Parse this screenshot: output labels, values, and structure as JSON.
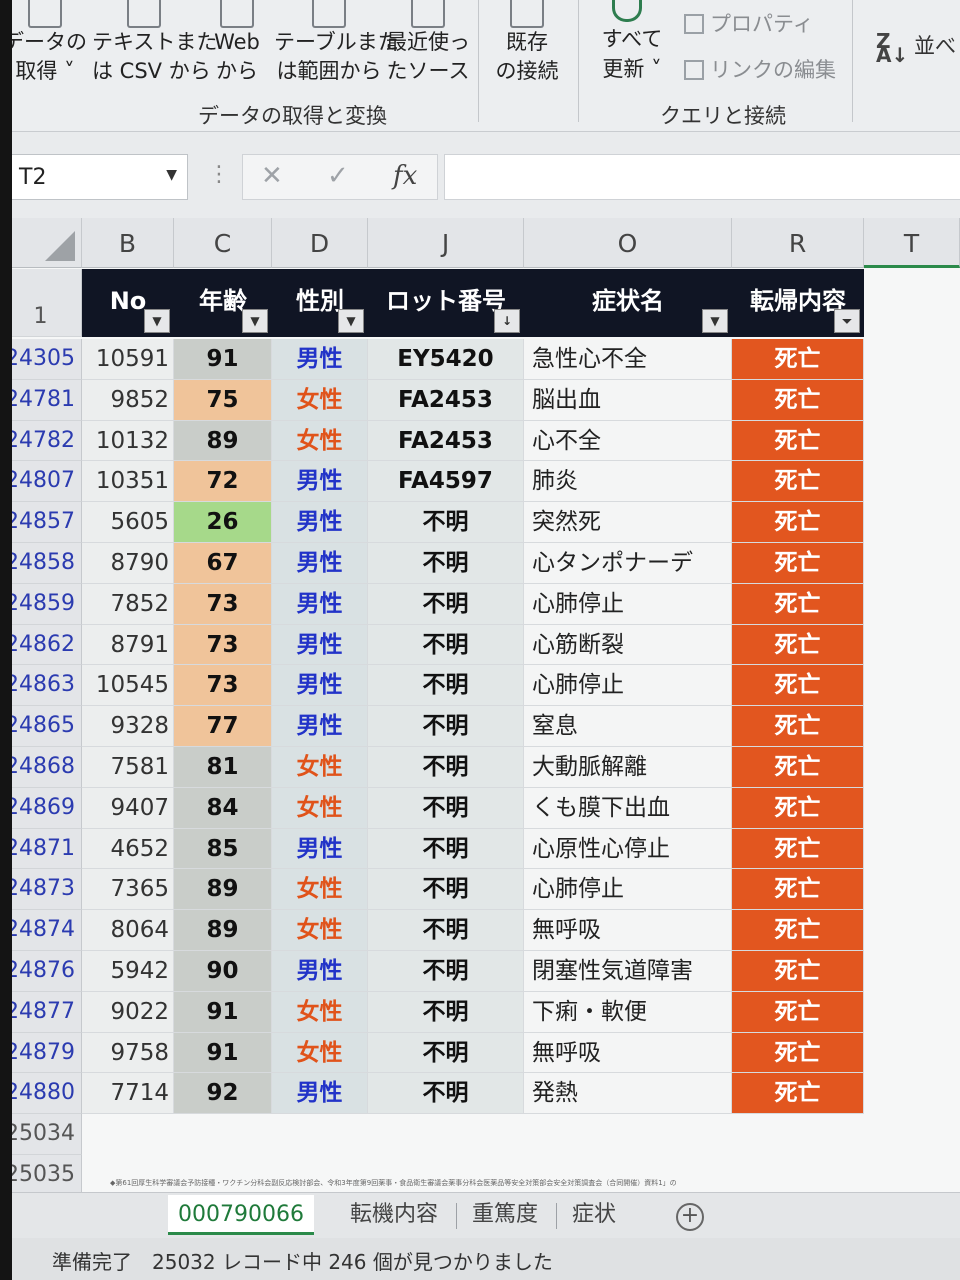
{
  "ribbon": {
    "buttons": [
      {
        "l1": "データの",
        "l2": "取得 ˅"
      },
      {
        "l1": "テキストまた",
        "l2": "は CSV から"
      },
      {
        "l1": "Web",
        "l2": "から"
      },
      {
        "l1": "テーブルまた",
        "l2": "は範囲から"
      },
      {
        "l1": "最近使っ",
        "l2": "たソース"
      },
      {
        "l1": "既存",
        "l2": "の接続"
      },
      {
        "l1": "すべて",
        "l2": "更新 ˅"
      }
    ],
    "properties": "プロパティ",
    "edit_links": "リンクの編集",
    "sort_label": "並べ",
    "group1": "データの取得と変換",
    "group2": "クエリと接続"
  },
  "formula_bar": {
    "name_box": "T2",
    "cancel": "✕",
    "enter": "✓",
    "fx": "fx",
    "value": ""
  },
  "columns": [
    {
      "letter": "B",
      "header": "No"
    },
    {
      "letter": "C",
      "header": "年齢"
    },
    {
      "letter": "D",
      "header": "性別"
    },
    {
      "letter": "J",
      "header": "ロット番号"
    },
    {
      "letter": "O",
      "header": "症状名"
    },
    {
      "letter": "R",
      "header": "転帰内容"
    },
    {
      "letter": "T",
      "header": ""
    }
  ],
  "header_row_number": "1",
  "rows": [
    {
      "row": "24305",
      "no": "10591",
      "age": "91",
      "sex": "男性",
      "lot": "EY5420",
      "symptom": "急性心不全",
      "outcome": "死亡"
    },
    {
      "row": "24781",
      "no": "9852",
      "age": "75",
      "sex": "女性",
      "lot": "FA2453",
      "symptom": "脳出血",
      "outcome": "死亡"
    },
    {
      "row": "24782",
      "no": "10132",
      "age": "89",
      "sex": "女性",
      "lot": "FA2453",
      "symptom": "心不全",
      "outcome": "死亡"
    },
    {
      "row": "24807",
      "no": "10351",
      "age": "72",
      "sex": "男性",
      "lot": "FA4597",
      "symptom": "肺炎",
      "outcome": "死亡"
    },
    {
      "row": "24857",
      "no": "5605",
      "age": "26",
      "sex": "男性",
      "lot": "不明",
      "symptom": "突然死",
      "outcome": "死亡"
    },
    {
      "row": "24858",
      "no": "8790",
      "age": "67",
      "sex": "男性",
      "lot": "不明",
      "symptom": "心タンポナーデ",
      "outcome": "死亡"
    },
    {
      "row": "24859",
      "no": "7852",
      "age": "73",
      "sex": "男性",
      "lot": "不明",
      "symptom": "心肺停止",
      "outcome": "死亡"
    },
    {
      "row": "24862",
      "no": "8791",
      "age": "73",
      "sex": "男性",
      "lot": "不明",
      "symptom": "心筋断裂",
      "outcome": "死亡"
    },
    {
      "row": "24863",
      "no": "10545",
      "age": "73",
      "sex": "男性",
      "lot": "不明",
      "symptom": "心肺停止",
      "outcome": "死亡"
    },
    {
      "row": "24865",
      "no": "9328",
      "age": "77",
      "sex": "男性",
      "lot": "不明",
      "symptom": "窒息",
      "outcome": "死亡"
    },
    {
      "row": "24868",
      "no": "7581",
      "age": "81",
      "sex": "女性",
      "lot": "不明",
      "symptom": "大動脈解離",
      "outcome": "死亡"
    },
    {
      "row": "24869",
      "no": "9407",
      "age": "84",
      "sex": "女性",
      "lot": "不明",
      "symptom": "くも膜下出血",
      "outcome": "死亡"
    },
    {
      "row": "24871",
      "no": "4652",
      "age": "85",
      "sex": "男性",
      "lot": "不明",
      "symptom": "心原性心停止",
      "outcome": "死亡"
    },
    {
      "row": "24873",
      "no": "7365",
      "age": "89",
      "sex": "女性",
      "lot": "不明",
      "symptom": "心肺停止",
      "outcome": "死亡"
    },
    {
      "row": "24874",
      "no": "8064",
      "age": "89",
      "sex": "女性",
      "lot": "不明",
      "symptom": "無呼吸",
      "outcome": "死亡"
    },
    {
      "row": "24876",
      "no": "5942",
      "age": "90",
      "sex": "男性",
      "lot": "不明",
      "symptom": "閉塞性気道障害",
      "outcome": "死亡"
    },
    {
      "row": "24877",
      "no": "9022",
      "age": "91",
      "sex": "女性",
      "lot": "不明",
      "symptom": "下痢・軟便",
      "outcome": "死亡"
    },
    {
      "row": "24879",
      "no": "9758",
      "age": "91",
      "sex": "女性",
      "lot": "不明",
      "symptom": "無呼吸",
      "outcome": "死亡"
    },
    {
      "row": "24880",
      "no": "7714",
      "age": "92",
      "sex": "男性",
      "lot": "不明",
      "symptom": "発熱",
      "outcome": "死亡"
    }
  ],
  "empty_rows": [
    "25034",
    "25035"
  ],
  "footnote": "◆第61回厚生科学審議会予防接種・ワクチン分科会副反応検討部会、令和3年度第9回薬事・食品衛生審議会薬事分科会医薬品等安全対策部会安全対策調査会（合同開催）資料1」の",
  "age_colors": {
    "26": "#a6d98a",
    "67": "#f0c49a",
    "72": "#f0c49a",
    "73": "#f0c49a",
    "75": "#f0c49a",
    "77": "#f0c49a",
    "default": "#c9cdc9"
  },
  "colors": {
    "male": "#2233c8",
    "female": "#e0531a",
    "outcome_bg": "#e2561f",
    "header_bg": "#101524"
  },
  "sheet_tabs": [
    "000790066",
    "転機内容",
    "重篤度",
    "症状"
  ],
  "status": {
    "ready": "準備完了",
    "records": "25032 レコード中 246 個が見つかりました"
  }
}
